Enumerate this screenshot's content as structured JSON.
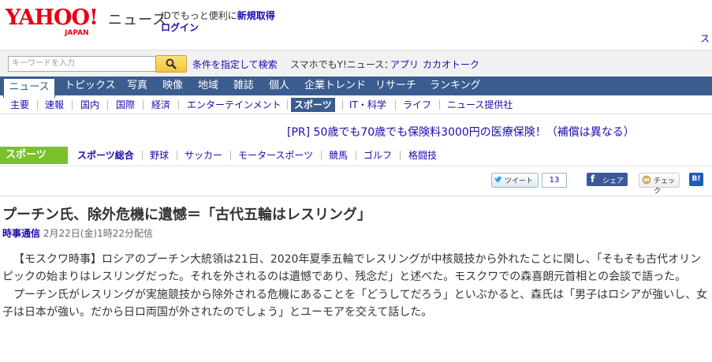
{
  "header": {
    "logo_text": "YAHOO!",
    "logo_sub": "JAPAN",
    "site_title": "ニュース",
    "promo_text": "IDでもっと便利に",
    "promo_link": "新規取得",
    "login": "ログイン",
    "edge_text": "ス"
  },
  "search": {
    "placeholder": "キーワードを入力",
    "conditions_link": "条件を指定して検索",
    "smartphone_label": "スマホでもY!ニュース：",
    "app_link": "アプリ",
    "kakao_link": "カカオトーク"
  },
  "main_nav": {
    "tabs": [
      "ニュース",
      "トピックス",
      "写真",
      "映像",
      "地域",
      "雑誌",
      "個人",
      "企業トレンド",
      "リサーチ",
      "ランキング"
    ],
    "active": "ニュース"
  },
  "sub_nav": {
    "items": [
      "主要",
      "速報",
      "国内",
      "国際",
      "経済",
      "エンターテインメント",
      "スポーツ",
      "IT・科学",
      "ライフ",
      "ニュース提供社"
    ],
    "active": "スポーツ"
  },
  "pr": {
    "text": "[PR] 50歳でも70歳でも保険料3000円の医療保険！（補償は異なる）"
  },
  "sports_nav": {
    "label": "スポーツ",
    "items": [
      "スポーツ総合",
      "野球",
      "サッカー",
      "モータースポーツ",
      "競馬",
      "ゴルフ",
      "格闘技"
    ]
  },
  "social": {
    "tweet": "ツイート",
    "tweet_count": "13",
    "share": "シェア",
    "check": "チェック",
    "hatena": "B!"
  },
  "article": {
    "headline": "プーチン氏、除外危機に遺憾＝「古代五輪はレスリング」",
    "source": "時事通信",
    "date": "2月22日(金)1時22分配信",
    "paragraphs": [
      "【モスクワ時事】ロシアのプーチン大統領は21日、2020年夏季五輪でレスリングが中核競技から外れたことに関し、「そもそも古代オリンピックの始まりはレスリングだった。それを外されるのは遺憾であり、残念だ」と述べた。モスクワでの森喜朗元首相との会談で語った。",
      "プーチン氏がレスリングが実施競技から除外される危機にあることを「どうしてだろう」といぶかると、森氏は「男子はロシアが強いし、女子は日本が強い。だから日ロ両国が外されたのでしょう」とユーモアを交えて話した。"
    ]
  },
  "colors": {
    "brand_red": "#e60012",
    "nav_blue": "#3a5c8f",
    "sports_green": "#7bc12a",
    "link_blue": "#1a0dab"
  }
}
